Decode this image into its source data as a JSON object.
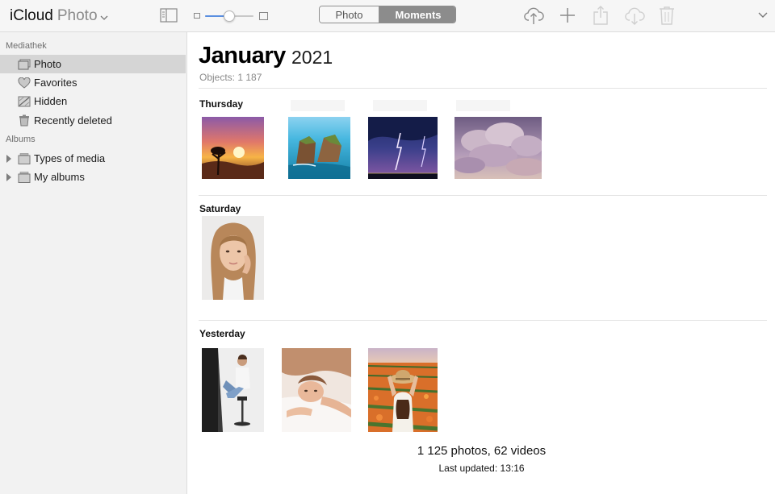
{
  "app": {
    "brand": "iCloud",
    "product": "Photo"
  },
  "toolbar": {
    "view_photo_label": "Photo",
    "view_moments_label": "Moments",
    "zoom_level": 0.5
  },
  "sidebar": {
    "library_heading": "Mediathek",
    "library_items": [
      {
        "label": "Photo",
        "icon": "photos-icon"
      },
      {
        "label": "Favorites",
        "icon": "heart-icon"
      },
      {
        "label": "Hidden",
        "icon": "hidden-icon"
      },
      {
        "label": "Recently deleted",
        "icon": "trash-icon"
      }
    ],
    "albums_heading": "Albums",
    "album_items": [
      {
        "label": "Types of media",
        "icon": "album-stack-icon"
      },
      {
        "label": "My albums",
        "icon": "album-stack-icon"
      }
    ]
  },
  "main": {
    "month": "January",
    "year": "2021",
    "objects_text": "Objects: 1 187",
    "sections": [
      {
        "day": "Thursday",
        "photos": [
          "sunset-tree-photo",
          "sea-rocks-photo",
          "lightning-storm-photo",
          "cloudy-sky-photo"
        ]
      },
      {
        "day": "Saturday",
        "photos": [
          "woman-portrait-photo"
        ]
      },
      {
        "day": "Yesterday",
        "photos": [
          "woman-on-stool-photo",
          "woman-lying-photo",
          "flower-field-photo"
        ]
      }
    ],
    "summary": "1 125 photos, 62 videos",
    "last_updated": "Last updated: 13:16"
  }
}
